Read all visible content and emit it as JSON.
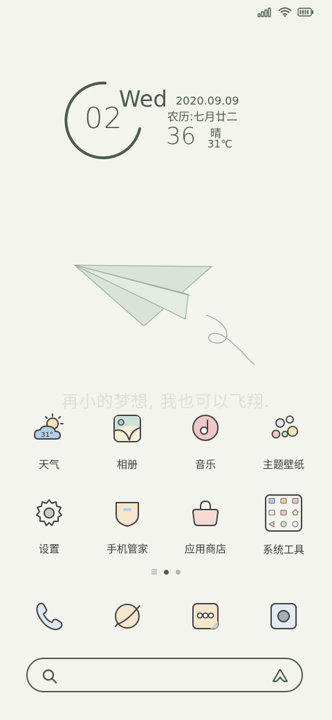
{
  "status_bar": {
    "signal_icon": "signal-icon",
    "wifi_icon": "wifi-icon",
    "battery_icon": "battery-icon"
  },
  "clock_widget": {
    "hour": "02",
    "weekday": "Wed",
    "date": "2020.09.09",
    "lunar": "农历:七月廿二",
    "minute": "36",
    "weather_condition": "晴",
    "temperature": "31℃"
  },
  "wallpaper_quote": "再小的梦想, 我也可以飞翔.",
  "apps": [
    {
      "label": "天气",
      "icon": "weather-icon",
      "badge": "31°"
    },
    {
      "label": "相册",
      "icon": "gallery-icon"
    },
    {
      "label": "音乐",
      "icon": "music-icon"
    },
    {
      "label": "主题壁纸",
      "icon": "themes-icon"
    },
    {
      "label": "设置",
      "icon": "settings-icon"
    },
    {
      "label": "手机管家",
      "icon": "security-icon"
    },
    {
      "label": "应用商店",
      "icon": "app-store-icon"
    },
    {
      "label": "系统工具",
      "icon": "tools-folder-icon"
    }
  ],
  "page_indicator": {
    "pages": 2,
    "current": 1
  },
  "dock": [
    {
      "icon": "phone-icon"
    },
    {
      "icon": "browser-icon"
    },
    {
      "icon": "messages-icon"
    },
    {
      "icon": "camera-icon"
    }
  ],
  "search_bar": {
    "search_icon": "search-icon",
    "assistant_icon": "assistant-icon"
  },
  "colors": {
    "background": "#f4f4ee",
    "accent": "#4e5e52",
    "label": "#3d3d3d"
  }
}
